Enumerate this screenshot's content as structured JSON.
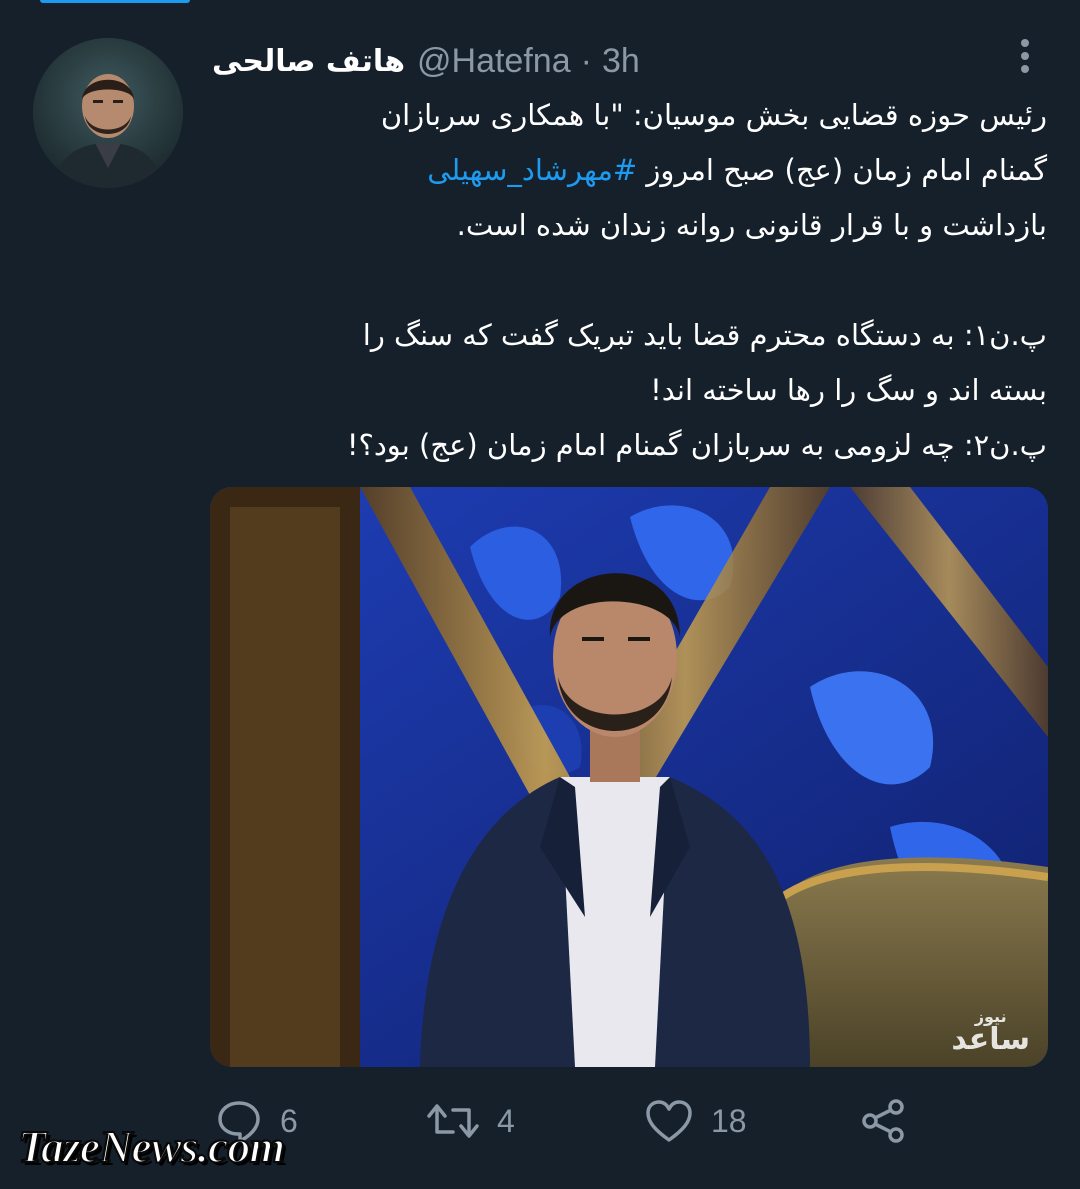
{
  "tweet": {
    "author_name": "هاتف صالحی",
    "handle": "@Hatefna",
    "separator": "·",
    "time": "3h",
    "more_icon": "more-vertical-icon",
    "text_lines": {
      "l1": "رئیس حوزه قضایی بخش موسیان: \"با همکاری سربازان",
      "l2_before": "گمنام امام زمان (عج) صبح امروز ",
      "l2_hashtag": "#مهرشاد_سهیلی",
      "l3": "بازداشت و با قرار قانونی روانه زندان شده است.",
      "l5": "پ.ن۱: به دستگاه محترم قضا باید تبریک گفت که سنگ را",
      "l6": "بسته اند و سگ را رها ساخته اند!",
      "l7": "پ.ن۲: چه لزومی به سربازان گمنام امام زمان (عج) بود؟!"
    },
    "media": {
      "watermark_top": "نیوز",
      "watermark_main": "ساعد"
    }
  },
  "actions": {
    "reply": {
      "icon": "reply-icon",
      "count": "6"
    },
    "retweet": {
      "icon": "retweet-icon",
      "count": "4"
    },
    "like": {
      "icon": "heart-icon",
      "count": "18"
    },
    "share": {
      "icon": "share-icon"
    }
  },
  "site_watermark": "TazeNews.com",
  "colors": {
    "background": "#16202b",
    "accent": "#1d9bf0",
    "muted_text": "#8b98a5",
    "text": "#ffffff"
  }
}
